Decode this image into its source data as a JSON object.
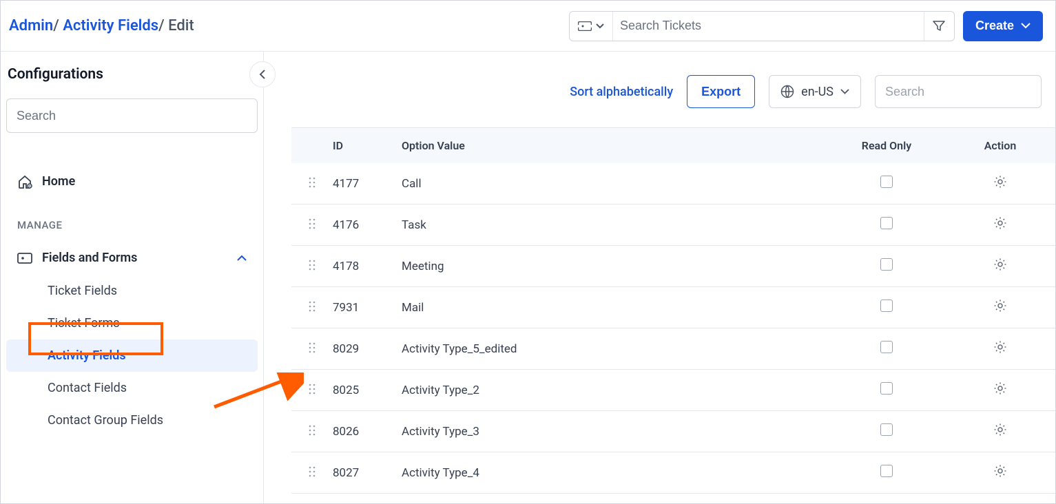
{
  "breadcrumb": {
    "part1": "Admin",
    "sep1": "/ ",
    "part2": "Activity Fields",
    "sep2": "/ ",
    "part3": "Edit"
  },
  "header": {
    "search_placeholder": "Search Tickets",
    "create_label": "Create"
  },
  "sidebar": {
    "title": "Configurations",
    "search_placeholder": "Search",
    "home_label": "Home",
    "section_label": "MANAGE",
    "fields_forms_label": "Fields and Forms",
    "items": {
      "ticket_fields": "Ticket Fields",
      "ticket_forms": "Ticket Forms",
      "activity_fields": "Activity Fields",
      "contact_fields": "Contact Fields",
      "contact_group_fields": "Contact Group Fields"
    }
  },
  "toolbar": {
    "sort_label": "Sort alphabetically",
    "export_label": "Export",
    "lang_label": "en-US",
    "search_placeholder": "Search"
  },
  "table": {
    "headers": {
      "id": "ID",
      "option_value": "Option Value",
      "read_only": "Read Only",
      "action": "Action"
    },
    "rows": [
      {
        "id": "4177",
        "value": "Call"
      },
      {
        "id": "4176",
        "value": "Task"
      },
      {
        "id": "4178",
        "value": "Meeting"
      },
      {
        "id": "7931",
        "value": "Mail"
      },
      {
        "id": "8029",
        "value": "Activity Type_5_edited"
      },
      {
        "id": "8025",
        "value": "Activity Type_2"
      },
      {
        "id": "8026",
        "value": "Activity Type_3"
      },
      {
        "id": "8027",
        "value": "Activity Type_4"
      }
    ]
  }
}
